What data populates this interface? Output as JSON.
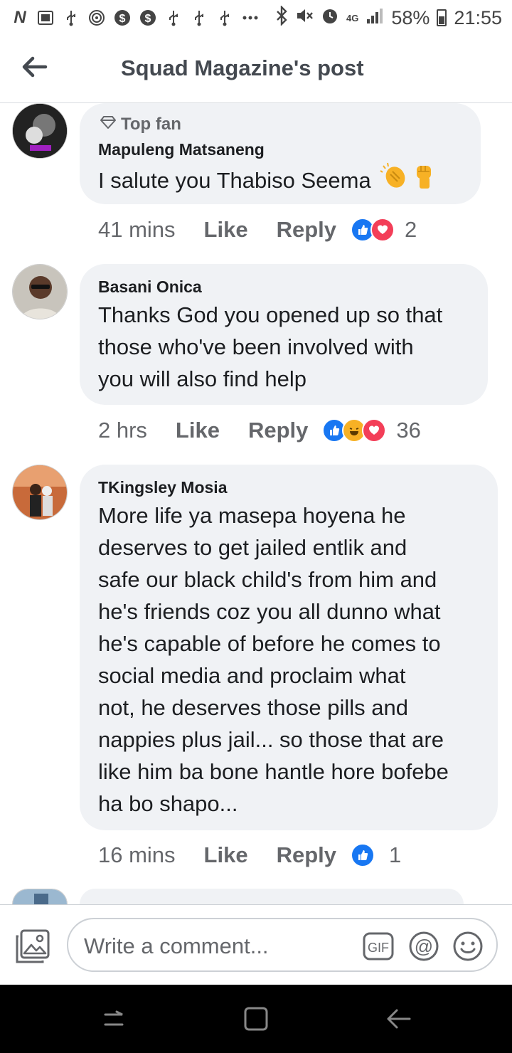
{
  "status_bar": {
    "battery": "58%",
    "time": "21:55",
    "network": "4G",
    "icons": [
      "n-icon",
      "image-box-icon",
      "usb-icon",
      "nfc-icon",
      "dollar-icon",
      "dollar-icon",
      "usb-icon",
      "usb-icon",
      "usb-icon",
      "more-dots-icon",
      "bluetooth-icon",
      "mute-icon",
      "alarm-icon",
      "signal-icon",
      "battery-icon"
    ]
  },
  "header": {
    "title": "Squad Magazine's post"
  },
  "comments": [
    {
      "badge": "Top fan",
      "author": "Mapuleng Matsaneng",
      "lines": [
        "I salute you Thabiso Seema"
      ],
      "emojis": [
        "clapping-hands-icon",
        "raised-fist-icon"
      ],
      "time": "41 mins",
      "like": "Like",
      "reply": "Reply",
      "reactions": [
        "like",
        "love"
      ],
      "count": "2"
    },
    {
      "author": "Basani Onica",
      "lines": [
        "Thanks God you opened up so that",
        "those who've been involved with",
        "you will also find help"
      ],
      "time": "2 hrs",
      "like": "Like",
      "reply": "Reply",
      "reactions": [
        "like",
        "haha",
        "love"
      ],
      "count": "36"
    },
    {
      "author": "TKingsley Mosia",
      "lines": [
        "More life ya masepa hoyena he",
        "deserves to get jailed entlik and",
        "safe our black child's from him and",
        "he's friends coz you all dunno what",
        "he's capable of before he comes to",
        "social media and proclaim what",
        "not, he deserves those pills and",
        "nappies plus jail... so those that are",
        "like him ba bone hantle hore bofebe",
        "ha bo shapo..."
      ],
      "time": "16 mins",
      "like": "Like",
      "reply": "Reply",
      "reactions": [
        "like"
      ],
      "count": "1"
    }
  ],
  "comment_bar": {
    "placeholder": "Write a comment...",
    "gif_label": "GIF",
    "at_label": "@"
  },
  "colors": {
    "bubble": "#f0f2f5",
    "meta_text": "#65676b",
    "like_blue": "#1877f2",
    "love_red": "#f33e58",
    "haha_yellow": "#f7b125"
  }
}
